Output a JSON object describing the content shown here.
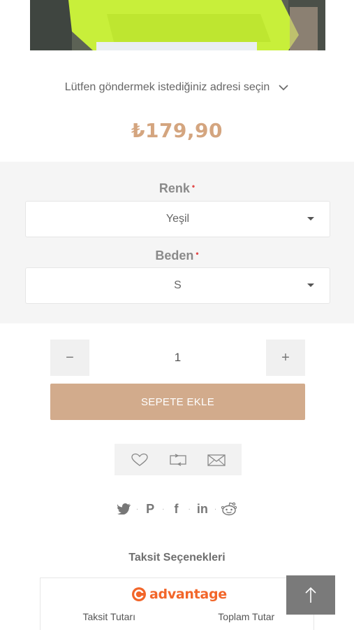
{
  "product": {
    "image_alt": "product-photo",
    "address_prompt": "Lütfen göndermek istediğiniz adresi seçin",
    "price": "₺179,90"
  },
  "options": {
    "color": {
      "label": "Renk",
      "required": "•",
      "value": "Yeşil"
    },
    "size": {
      "label": "Beden",
      "required": "•",
      "value": "S"
    }
  },
  "quantity": {
    "minus": "−",
    "value": "1",
    "plus": "+"
  },
  "cart": {
    "add_label": "SEPETE EKLE"
  },
  "actions": {
    "icons": [
      "heart-icon",
      "compare-icon",
      "mail-icon"
    ]
  },
  "share": {
    "twitter": "🐦",
    "pinterest": "P",
    "facebook": "f",
    "linkedin": "in",
    "reddit": "reddit",
    "separator": "·"
  },
  "installments": {
    "title": "Taksit Seçenekleri",
    "brand": "advantage",
    "col_amount": "Taksit Tutarı",
    "col_total": "Toplam Tutar"
  },
  "colors": {
    "price": "#d4a57f",
    "cart_button": "#d2ab8c",
    "brand": "#f2662a"
  }
}
